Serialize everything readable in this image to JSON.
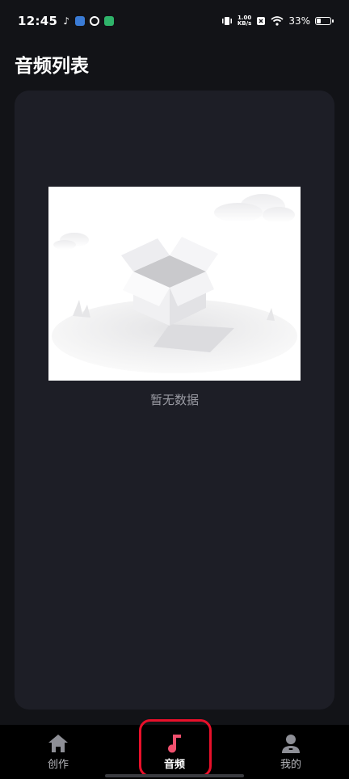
{
  "status_bar": {
    "time": "12:45",
    "net_speed_value": "1.00",
    "net_speed_unit": "KB/s",
    "battery_percent": "33%",
    "battery_level": 0.33
  },
  "page": {
    "title": "音频列表"
  },
  "empty_state": {
    "text": "暂无数据"
  },
  "tab_bar": {
    "tabs": [
      {
        "label": "创作",
        "icon": "home-icon",
        "active": false
      },
      {
        "label": "音频",
        "icon": "music-note-icon",
        "active": true
      },
      {
        "label": "我的",
        "icon": "user-icon",
        "active": false
      }
    ]
  },
  "colors": {
    "background": "#121317",
    "card": "#1d1e26",
    "active_icon": "#f0506e",
    "highlight": "#e8102a"
  }
}
